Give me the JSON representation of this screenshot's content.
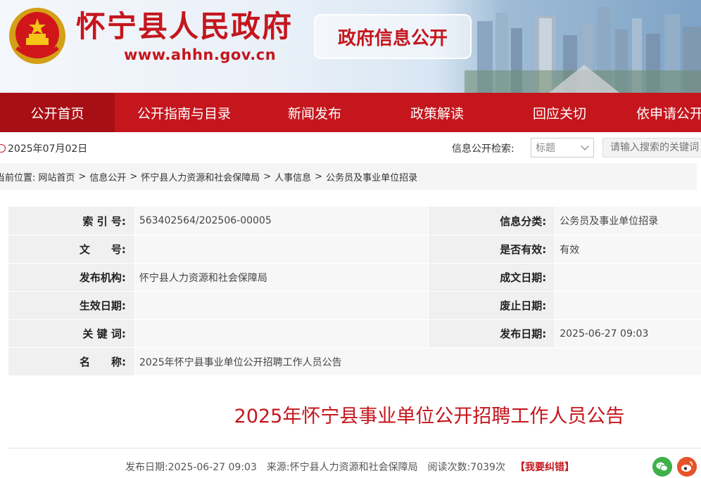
{
  "header": {
    "site_title": "怀宁县人民政府",
    "site_url": "www.ahhn.gov.cn",
    "portal_title": "政府信息公开",
    "brand_color": "#c5161d"
  },
  "nav": {
    "items": [
      {
        "label": "公开首页",
        "active": true
      },
      {
        "label": "公开指南与目录",
        "active": false
      },
      {
        "label": "新闻发布",
        "active": false
      },
      {
        "label": "政策解读",
        "active": false
      },
      {
        "label": "回应关切",
        "active": false
      },
      {
        "label": "依申请公开",
        "active": false
      }
    ]
  },
  "infobar": {
    "date": "2025年07月02日",
    "search_label": "信息公开检索:",
    "select_value": "标题",
    "search_placeholder": "请输入搜索的关键词"
  },
  "breadcrumb": {
    "prefix": "当前位置:",
    "items": [
      "网站首页",
      "信息公开",
      "怀宁县人力资源和社会保障局",
      "人事信息",
      "公务员及事业单位招录"
    ],
    "separator": ">"
  },
  "meta": {
    "index_no": {
      "label": "索 引 号:",
      "value": "563402564/202506-00005"
    },
    "category": {
      "label": "信息分类:",
      "value": "公务员及事业单位招录"
    },
    "doc_no": {
      "label": "文　　号:",
      "value": ""
    },
    "valid": {
      "label": "是否有效:",
      "value": "有效"
    },
    "publisher": {
      "label": "发布机构:",
      "value": "怀宁县人力资源和社会保障局"
    },
    "written_date": {
      "label": "成文日期:",
      "value": ""
    },
    "effective_date": {
      "label": "生效日期:",
      "value": ""
    },
    "expire_date": {
      "label": "废止日期:",
      "value": ""
    },
    "keywords": {
      "label": "关 键 词:",
      "value": ""
    },
    "publish_date": {
      "label": "发布日期:",
      "value": "2025-06-27 09:03"
    },
    "name": {
      "label": "名　　称:",
      "value": "2025年怀宁县事业单位公开招聘工作人员公告"
    }
  },
  "article": {
    "title": "2025年怀宁县事业单位公开招聘工作人员公告",
    "publish_date": "发布日期:2025-06-27 09:03",
    "source": "来源:怀宁县人力资源和社会保障局",
    "views": "阅读次数:7039次",
    "report_label": "【我要纠错】"
  },
  "share": {
    "wechat_color": "#3fb14b",
    "weibo_color": "#e6542a"
  }
}
